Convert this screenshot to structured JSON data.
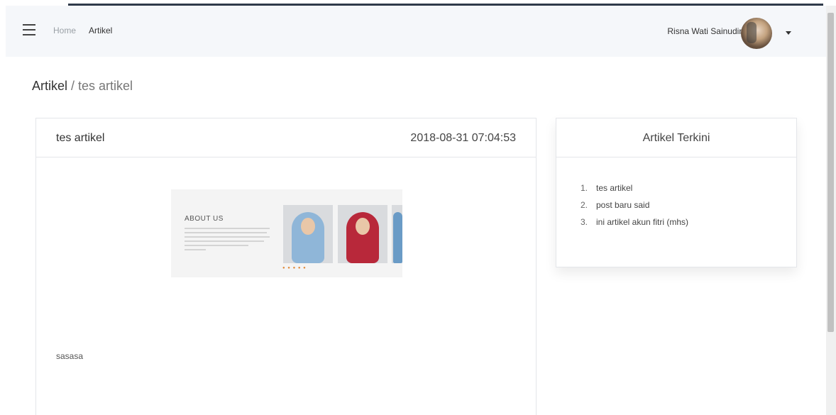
{
  "navbar": {
    "breadcrumb_home": "Home",
    "breadcrumb_current": "Artikel",
    "user_name": "Risna Wati Sainudin"
  },
  "page": {
    "breadcrumb_main": "Artikel",
    "breadcrumb_separator": " / ",
    "breadcrumb_sub": "tes artikel"
  },
  "article": {
    "title": "tes artikel",
    "date": "2018-08-31 07:04:53",
    "image_heading": "ABOUT US",
    "body": "sasasa"
  },
  "sidebar": {
    "title": "Artikel Terkini",
    "items": [
      {
        "num": "1.",
        "label": "tes artikel"
      },
      {
        "num": "2.",
        "label": "post baru said"
      },
      {
        "num": "3.",
        "label": "ini artikel akun fitri (mhs)"
      }
    ]
  },
  "colors": {
    "navbar_bg": "#f5f7fa",
    "hijab_blue": "#8fb6d8",
    "hijab_red": "#b8283a",
    "card_border": "#e4e6ea"
  }
}
